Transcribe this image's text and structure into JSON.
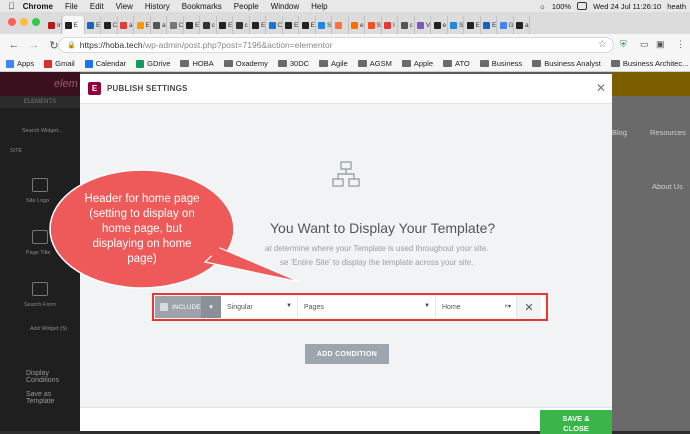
{
  "menubar": {
    "apple": "",
    "app": "Chrome",
    "items": [
      "File",
      "Edit",
      "View",
      "History",
      "Bookmarks",
      "People",
      "Window",
      "Help"
    ],
    "battery": "100%",
    "datetime": "Wed 24 Jul  11:26:10",
    "user": "heath"
  },
  "tabs": [
    "Ir",
    "E",
    "E",
    "C",
    "a",
    "E",
    "a",
    "C",
    "E",
    "c",
    "E",
    "c",
    "E",
    "C",
    "E",
    "E",
    "S",
    "",
    "e",
    "S",
    "I",
    "c",
    "V",
    "e",
    "S",
    "E",
    "E",
    "G",
    "a"
  ],
  "omnibox": {
    "domain": "https://hoba.tech",
    "path": "/wp-admin/post.php?post=7196&action=elementor"
  },
  "bookmarks": [
    {
      "label": "Apps",
      "icon": "apps-grid-icon"
    },
    {
      "label": "Gmail",
      "icon": "gmail-icon"
    },
    {
      "label": "Calendar",
      "icon": "calendar-icon"
    },
    {
      "label": "GDrive",
      "icon": "drive-icon"
    },
    {
      "label": "HOBA",
      "icon": "folder-icon"
    },
    {
      "label": "Oxademy",
      "icon": "folder-icon"
    },
    {
      "label": "30DC",
      "icon": "folder-icon"
    },
    {
      "label": "Agile",
      "icon": "folder-icon"
    },
    {
      "label": "AGSM",
      "icon": "folder-icon"
    },
    {
      "label": "Apple",
      "icon": "folder-icon"
    },
    {
      "label": "ATO",
      "icon": "folder-icon"
    },
    {
      "label": "Business",
      "icon": "folder-icon"
    },
    {
      "label": "Business Analyst",
      "icon": "folder-icon"
    },
    {
      "label": "Business Architec...",
      "icon": "folder-icon"
    }
  ],
  "sidebar": {
    "logo": "elem",
    "tab": "ELEMENTS",
    "search": "Search Widget...",
    "section": "SITE",
    "widgets": [
      "Site Logo",
      "Page Title",
      "Search Form"
    ],
    "footer_items": [
      "Add Widget (S)",
      "",
      "Display Conditions",
      "Save as Template"
    ]
  },
  "site": {
    "nav": [
      "Blog",
      "Resources",
      "About Us"
    ]
  },
  "modal": {
    "title": "PUBLISH SETTINGS",
    "logo": "E",
    "heading": "You Want to Display Your Template?",
    "desc_line1": "at determine where your Template is used throughout your site.",
    "desc_line2": "se 'Entire Site' to display the template across your site.",
    "condition": {
      "include": "INCLUDE",
      "scope": "Singular",
      "type": "Pages",
      "target": "Home"
    },
    "add_condition": "ADD CONDITION",
    "save_close_line1": "SAVE &",
    "save_close_line2": "CLOSE"
  },
  "callout": {
    "text": "Header for home page (setting to display on home page, but displaying on home page)",
    "lines": [
      "Header for home page",
      "(setting to display on",
      "home page, but",
      "displaying on home",
      "page)"
    ],
    "color": "#ee5a5a"
  },
  "colors": {
    "accent": "#92003b",
    "highlight": "#e53935",
    "save": "#39b54a"
  }
}
